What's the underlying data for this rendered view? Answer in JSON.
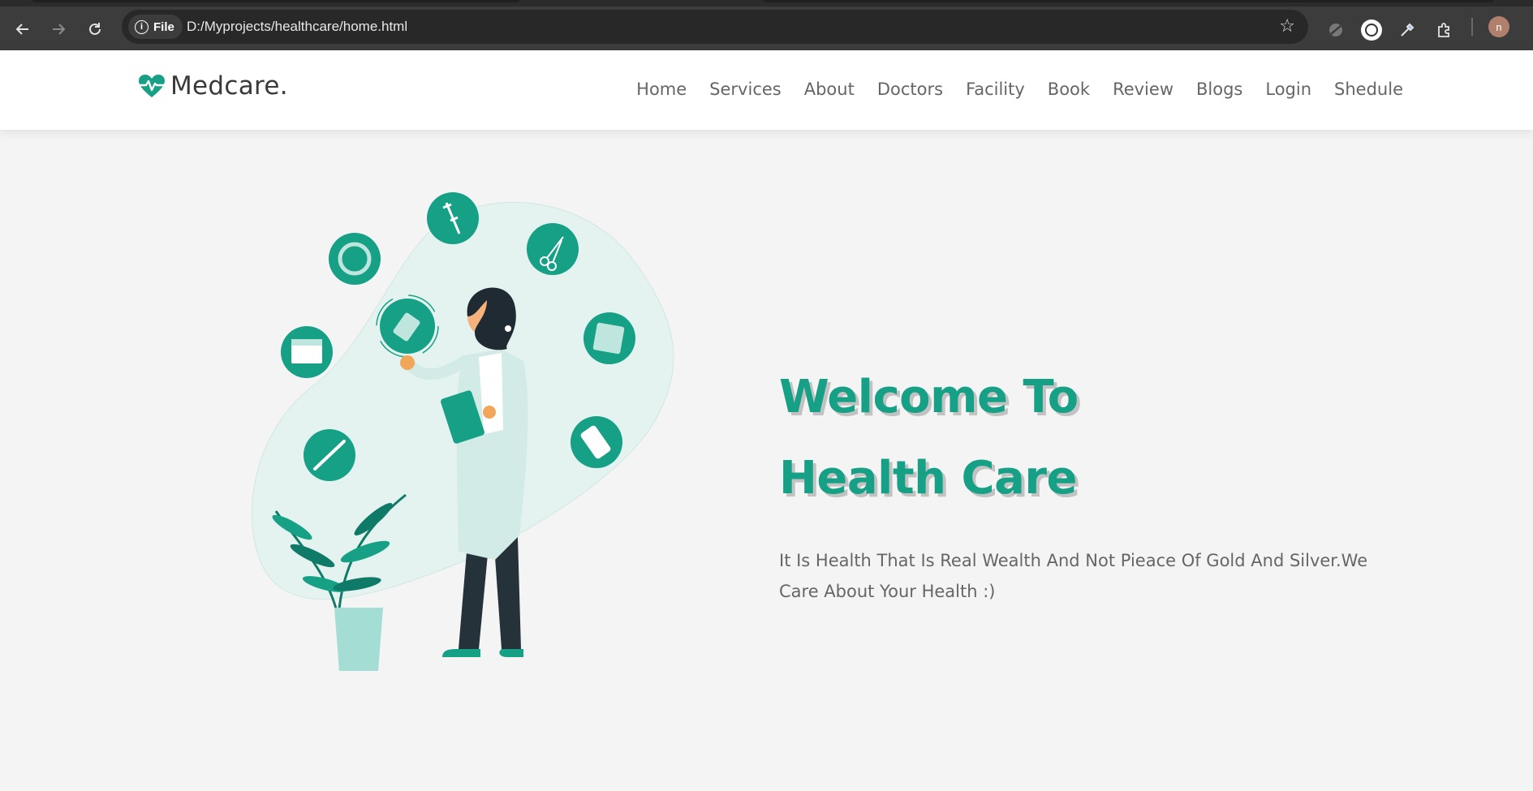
{
  "browser": {
    "omnibox": {
      "chip_label": "File",
      "url": "D:/Myprojects/healthcare/home.html"
    },
    "profile_initial": "n",
    "icons": [
      "back-arrow-icon",
      "forward-arrow-icon",
      "reload-icon",
      "info-icon",
      "star-icon",
      "blocked-extension-icon",
      "extension-circle-icon",
      "eyedropper-icon",
      "puzzle-extensions-icon"
    ]
  },
  "site": {
    "logo_text": "Medcare.",
    "nav": [
      "Home",
      "Services",
      "About",
      "Doctors",
      "Facility",
      "Book",
      "Review",
      "Blogs",
      "Login",
      "Shedule"
    ],
    "hero": {
      "title_line1": "Welcome To",
      "title_line2": "Health Care",
      "subtitle": "It Is Health That Is Real Wealth And Not Pieace Of Gold And Silver.We Care About Your Health :)"
    },
    "colors": {
      "brand": "#16a085",
      "blob": "#e4f3f0",
      "text": "#666666",
      "background": "#f4f4f4"
    }
  }
}
